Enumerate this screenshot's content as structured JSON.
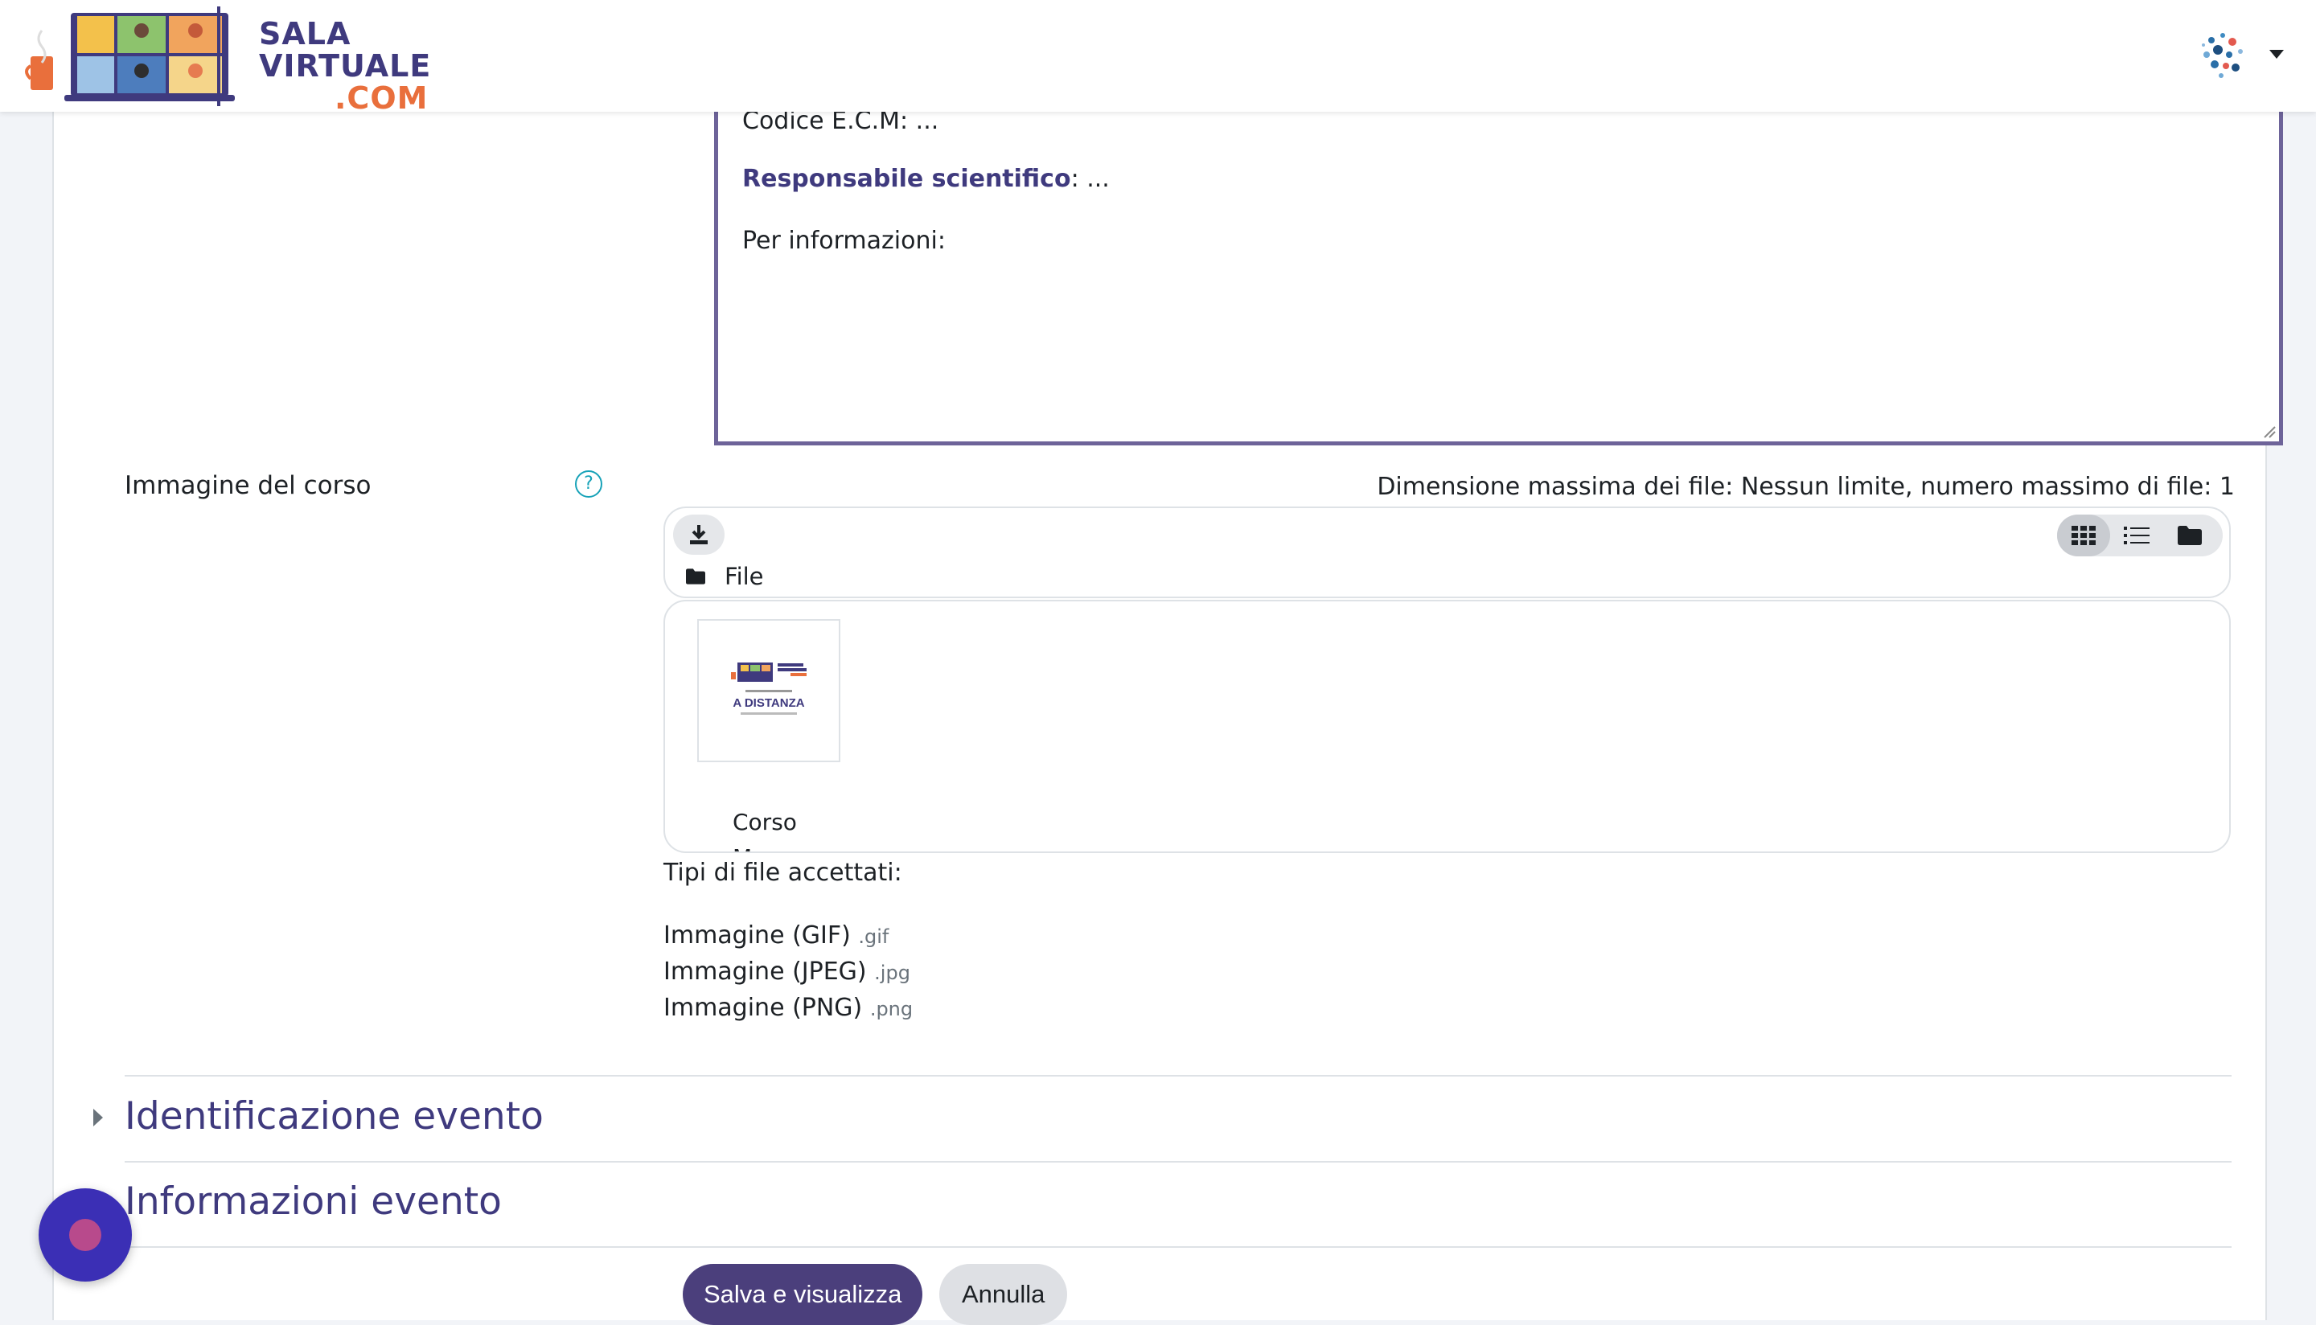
{
  "navbar": {
    "brand_line1": "SALA",
    "brand_line2": "VIRTUALE",
    "brand_line3": ".COM"
  },
  "editor": {
    "line1": "Codice E.C.M: ...",
    "line2_bold": "Responsabile scientifico",
    "line2_rest": ": ...",
    "line3": "Per informazioni:"
  },
  "course_image": {
    "label": "Immagine del corso",
    "help": "?",
    "max_size": "Dimensione massima dei file: Nessun limite, numero massimo di file: 1",
    "path_label": "File",
    "thumb_caption": "A DISTANZA",
    "file_name": "Corso",
    "file_name_cont": "Ma...",
    "accepted_title": "Tipi di file accettati:",
    "accepted_types": [
      {
        "name": "Immagine (GIF)",
        "ext": ".gif"
      },
      {
        "name": "Immagine (JPEG)",
        "ext": ".jpg"
      },
      {
        "name": "Immagine (PNG)",
        "ext": ".png"
      }
    ]
  },
  "sections": {
    "identificazione": "Identificazione evento",
    "informazioni": "Informazioni evento"
  },
  "buttons": {
    "save": "Salva e visualizza",
    "cancel": "Annulla"
  },
  "colors": {
    "brand_purple": "#3f3a7e",
    "brand_orange": "#e96f3c",
    "primary_button": "#4b3f7c",
    "chat_fab": "#3b2fb5"
  }
}
